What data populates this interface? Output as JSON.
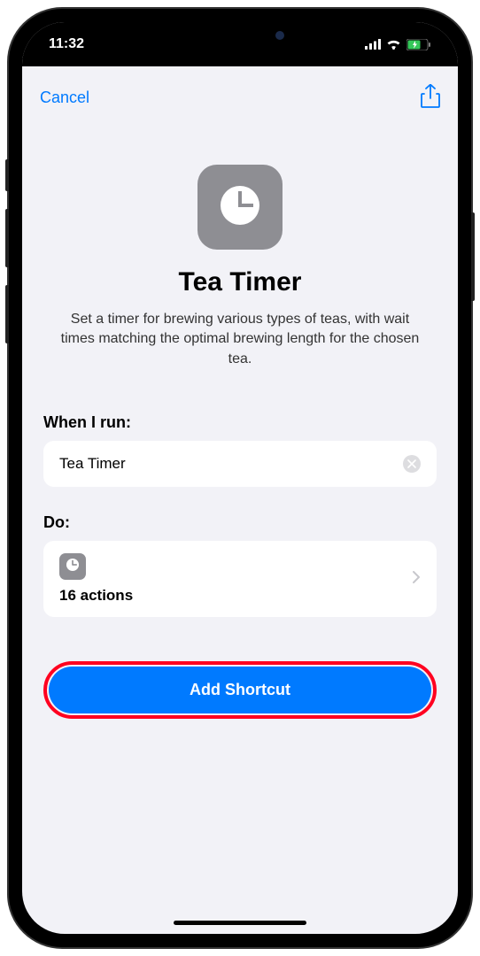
{
  "status_bar": {
    "time": "11:32"
  },
  "nav": {
    "cancel_label": "Cancel"
  },
  "shortcut": {
    "title": "Tea Timer",
    "description": "Set a timer for brewing various types of teas, with wait times matching the optimal brewing length for the chosen tea."
  },
  "when_run": {
    "label": "When I run:",
    "value": "Tea Timer"
  },
  "do_section": {
    "label": "Do:",
    "actions_count": "16 actions"
  },
  "add_button": {
    "label": "Add Shortcut"
  }
}
